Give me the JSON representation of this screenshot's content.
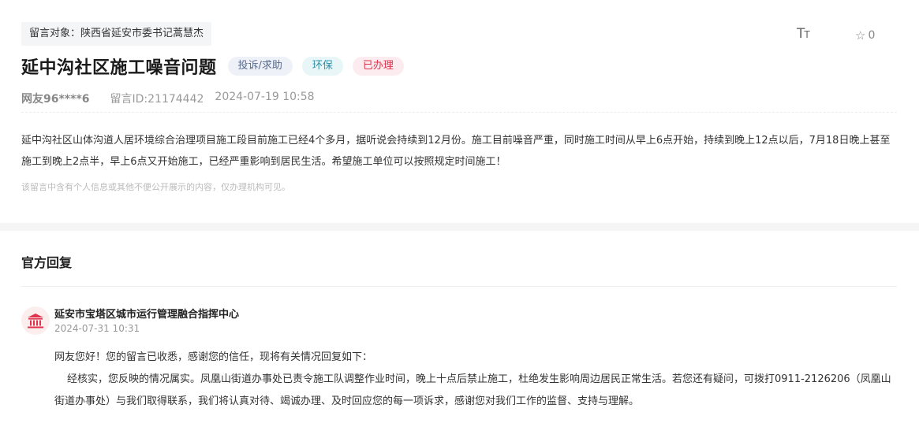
{
  "post": {
    "target_label": "留言对象：陕西省延安市委书记蒿慧杰",
    "font_tool_icon": "font-size-icon",
    "favorite_count": "0",
    "title": "延中沟社区施工噪音问题",
    "tags": {
      "category": "投诉/求助",
      "topic": "环保",
      "status": "已办理"
    },
    "author": "网友96****6",
    "message_id": "留言ID:21174442",
    "datetime": "2024-07-19 10:58",
    "content": "延中沟社区山体沟道人居环境综合治理项目施工段目前施工已经4个多月，据听说会持续到12月份。施工目前噪音严重，同时施工时间从早上6点开始，持续到晚上12点以后，7月18日晚上甚至施工到晚上2点半，早上6点又开始施工，已经严重影响到居民生活。希望施工单位可以按照规定时间施工！",
    "privacy_note": "该留言中含有个人信息或其他不便公开展示的内容，仅办理机构可见。"
  },
  "reply": {
    "section_title": "官方回复",
    "org_icon": "government-building-icon",
    "org": "延安市宝塔区城市运行管理融合指挥中心",
    "datetime": "2024-07-31 10:31",
    "greeting": "网友您好！您的留言已收悉，感谢您的信任，现将有关情况回复如下：",
    "body": "经核实，您反映的情况属实。凤凰山街道办事处已责令施工队调整作业时间，晚上十点后禁止施工，杜绝发生影响周边居民正常生活。若您还有疑问，可拨打0911-2126206（凤凰山街道办事处）与我们取得联系，我们将认真对待、竭诚办理、及时回应您的每一项诉求，感谢您对我们工作的监督、支持与理解。"
  },
  "colors": {
    "status_red": "#e0324c",
    "topic_teal": "#2f8fa8",
    "category_gray": "#5a6b8c",
    "section_band": "#f5f5f5"
  }
}
